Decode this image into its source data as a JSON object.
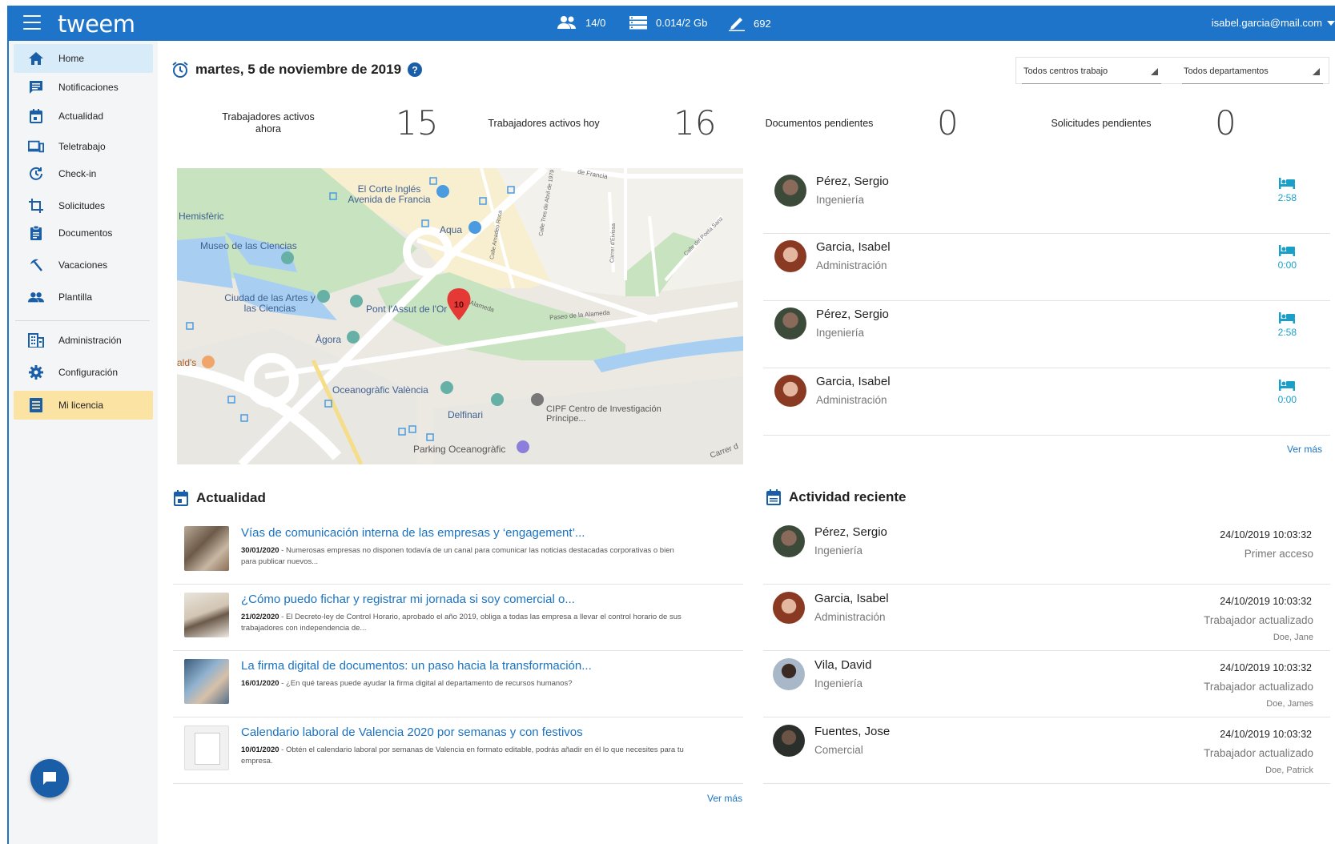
{
  "topbar": {
    "logo": "tweem",
    "workers": "14/0",
    "storage": "0.014/2 Gb",
    "signatures": "692",
    "user_email": "isabel.garcia@mail.com"
  },
  "sidebar": {
    "items": [
      {
        "label": "Home",
        "icon": "home-icon"
      },
      {
        "label": "Notificaciones",
        "icon": "message-icon"
      },
      {
        "label": "Actualidad",
        "icon": "calendar-icon"
      },
      {
        "label": "Teletrabajo",
        "icon": "devices-icon"
      },
      {
        "label": "Check-in",
        "icon": "clock-icon"
      },
      {
        "label": "Solicitudes",
        "icon": "crop-icon"
      },
      {
        "label": "Documentos",
        "icon": "clipboard-icon"
      },
      {
        "label": "Vacaciones",
        "icon": "beach-icon"
      },
      {
        "label": "Plantilla",
        "icon": "people-icon"
      },
      {
        "label": "Administración",
        "icon": "building-icon"
      },
      {
        "label": "Configuración",
        "icon": "gear-icon"
      },
      {
        "label": "Mi licencia",
        "icon": "list-icon"
      }
    ]
  },
  "header": {
    "date": "martes, 5 de noviembre de 2019",
    "filter_centers": "Todos centros trabajo",
    "filter_departments": "Todos departamentos"
  },
  "kpis": [
    {
      "label": "Trabajadores activos ahora",
      "value": "15"
    },
    {
      "label": "Trabajadores activos hoy",
      "value": "16"
    },
    {
      "label": "Documentos pendientes",
      "value": "0"
    },
    {
      "label": "Solicitudes pendientes",
      "value": "0"
    }
  ],
  "map_labels": {
    "corte_ingles": "El Corte Inglés Avenida de Francia",
    "hemisferic": "Hemisfèric",
    "aqua": "Aqua",
    "museo": "Museo de las Ciencias",
    "ciudad": "Ciudad de las Artes y las Ciencias",
    "pont": "Pont l'Assut de l'Or",
    "agora": "Àgora",
    "oceanografic": "Oceanogràfic València",
    "delfinari": "Delfinari",
    "cipf": "CIPF Centro de Investigación Príncipe...",
    "parking": "Parking Oceanogràfic",
    "alds": "ald's",
    "paseo": "Paseo de la Alameda",
    "alameda": "Alameda",
    "carrer": "Carrer d",
    "calle_poeta": "Calle del Poeta Sanz",
    "calle_tres": "Calle Tres de Abril de 1979",
    "calle_amadeo": "Calle Amadeo Roca",
    "carrer_eivissa": "Carrer d'Eivissa",
    "francia": "de Francia",
    "marker": "10"
  },
  "presence": [
    {
      "name": "Pérez, Sergio",
      "dept": "Ingeniería",
      "time": "2:58"
    },
    {
      "name": "Garcia, Isabel",
      "dept": "Administración",
      "time": "0:00"
    },
    {
      "name": "Pérez, Sergio",
      "dept": "Ingeniería",
      "time": "2:58"
    },
    {
      "name": "Garcia, Isabel",
      "dept": "Administración",
      "time": "0:00"
    }
  ],
  "presence_more": "Ver más",
  "news": {
    "title": "Actualidad",
    "items": [
      {
        "title": "Vías de comunicación interna de las empresas y ‘engagement’...",
        "date": "30/01/2020",
        "text": " - Numerosas empresas no disponen todavía de un canal para comunicar las noticias destacadas corporativas o bien para publicar nuevos..."
      },
      {
        "title": "¿Cómo puedo fichar y registrar mi jornada si soy comercial o...",
        "date": "21/02/2020",
        "text": " - El Decreto-ley de Control Horario, aprobado el año 2019, obliga a todas las empresa a llevar el control horario de sus trabajadores con independencia de..."
      },
      {
        "title": "La firma digital de documentos: un paso hacia la transformación...",
        "date": "16/01/2020",
        "text": " - ¿En qué tareas puede ayudar la firma digital al departamento de recursos humanos?"
      },
      {
        "title": "Calendario laboral de Valencia 2020 por semanas y con festivos",
        "date": "10/01/2020",
        "text": " - Obtén el calendario laboral por semanas de Valencia en formato editable, podrás añadir en él lo que necesites para tu empresa."
      }
    ],
    "more": "Ver más"
  },
  "activity": {
    "title": "Actividad reciente",
    "items": [
      {
        "name": "Pérez, Sergio",
        "dept": "Ingeniería",
        "date": "24/10/2019 10:03:32",
        "action": "Primer acceso",
        "by": ""
      },
      {
        "name": "Garcia, Isabel",
        "dept": "Administración",
        "date": "24/10/2019 10:03:32",
        "action": "Trabajador actualizado",
        "by": "Doe, Jane"
      },
      {
        "name": "Vila, David",
        "dept": "Ingeniería",
        "date": "24/10/2019 10:03:32",
        "action": "Trabajador actualizado",
        "by": "Doe, James"
      },
      {
        "name": "Fuentes, Jose",
        "dept": "Comercial",
        "date": "24/10/2019 10:03:32",
        "action": "Trabajador actualizado",
        "by": "Doe, Patrick"
      }
    ]
  },
  "colors": {
    "brand_blue": "#1e74c8",
    "link_blue": "#1a73c2",
    "time_cyan": "#1aa0c8",
    "active_nav": "#d8ebf8",
    "license_nav": "#fbe3a3"
  }
}
